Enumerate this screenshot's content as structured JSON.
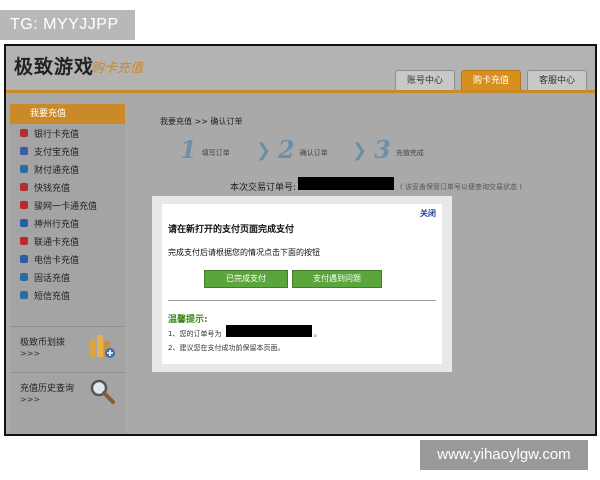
{
  "watermark_top": "TG: MYYJJPP",
  "watermark_bottom": "www.yihaoylgw.com",
  "header": {
    "logo_main": "极致游戏",
    "logo_sub": "购卡充值",
    "tabs": [
      {
        "label": "账号中心",
        "active": false
      },
      {
        "label": "购卡充值",
        "active": true
      },
      {
        "label": "客服中心",
        "active": false
      }
    ]
  },
  "sidebar": {
    "title": "我要充值",
    "items": [
      {
        "label": "银行卡充值",
        "icon": "bank-card-icon",
        "color": "#b03030"
      },
      {
        "label": "支付宝充值",
        "icon": "alipay-icon",
        "color": "#3b5ba8"
      },
      {
        "label": "财付通充值",
        "icon": "tenpay-icon",
        "color": "#2d6aa8"
      },
      {
        "label": "快钱充值",
        "icon": "kuaiqian-icon",
        "color": "#b03030"
      },
      {
        "label": "骏网一卡通充值",
        "icon": "junnet-icon",
        "color": "#c0262c"
      },
      {
        "label": "神州行充值",
        "icon": "shenzhouxing-icon",
        "color": "#2a5ea4"
      },
      {
        "label": "联通卡充值",
        "icon": "unicom-icon",
        "color": "#c0262c"
      },
      {
        "label": "电信卡充值",
        "icon": "telecom-icon",
        "color": "#2a5ea4"
      },
      {
        "label": "固话充值",
        "icon": "phone-icon",
        "color": "#2d6aa8"
      },
      {
        "label": "短信充值",
        "icon": "sms-icon",
        "color": "#2d6aa8"
      }
    ],
    "block1": {
      "label": "极致币划拨",
      "arrow": ">>>"
    },
    "block2": {
      "label": "充值历史查询",
      "arrow": ">>>"
    }
  },
  "main": {
    "breadcrumb": "我要充值 >> 确认订单",
    "steps": [
      {
        "num": "1",
        "label": "填写订单"
      },
      {
        "num": "2",
        "label": "确认订单"
      },
      {
        "num": "3",
        "label": "充值完成"
      }
    ],
    "order_label": "本次交易订单号:",
    "order_note": "( 该妥善保管订单号以便查询交易状态 )"
  },
  "dialog": {
    "close": "关闭",
    "title": "请在新打开的支付页面完成支付",
    "message": "完成支付后请根据您的情况点击下面的按钮",
    "btn_done": "已完成支付",
    "btn_problem": "支付遇到问题",
    "tips_title": "温馨提示:",
    "tip1_prefix": "1、您的订单号为",
    "tip1_suffix": "。",
    "tip2": "2、建议您在支付成功前保留本页面。"
  },
  "colors": {
    "accent": "#c98a27",
    "button_green": "#5aa63c",
    "tips_green": "#3a8a1a",
    "link_blue": "#1a3d9a"
  }
}
